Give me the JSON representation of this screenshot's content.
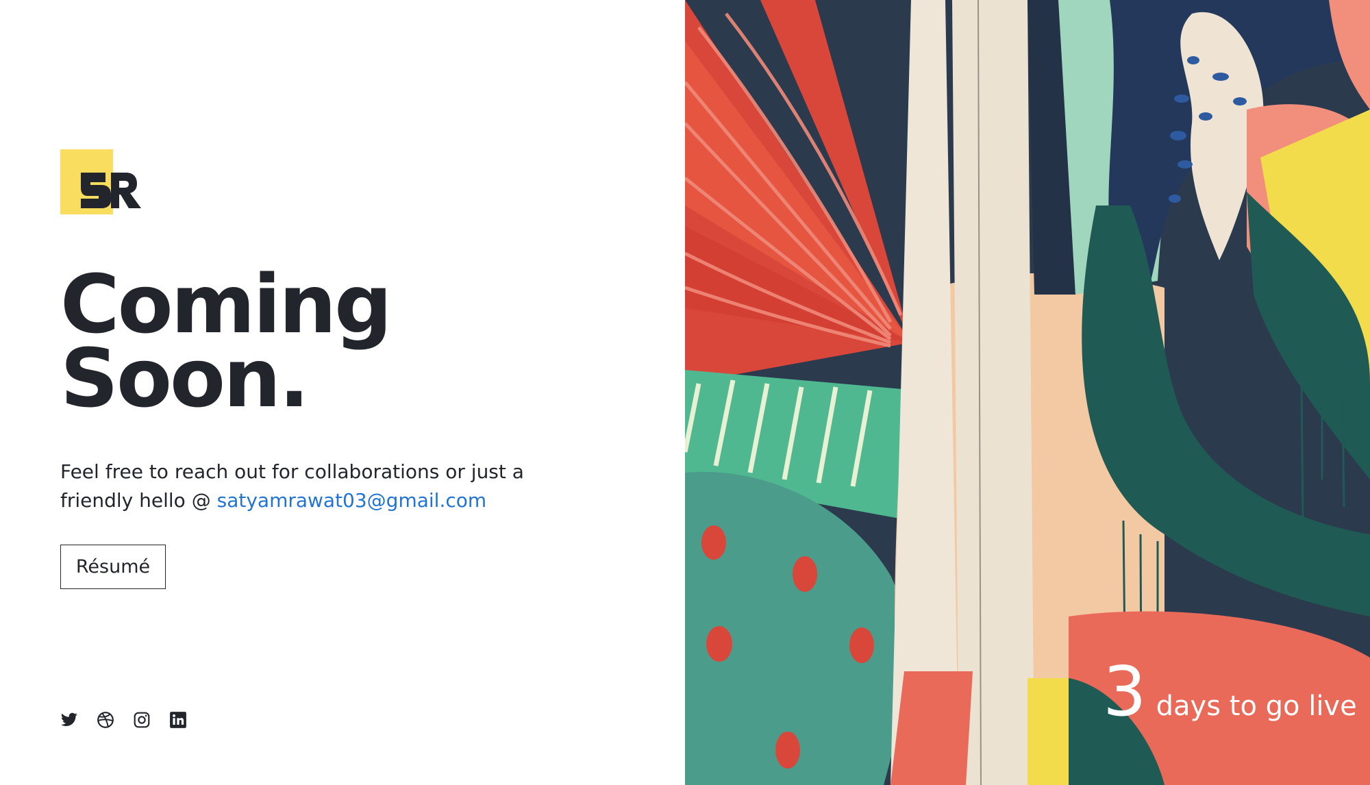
{
  "brand": {
    "logo_icon": "sr-monogram-logo",
    "accent_color": "#f8dd5e"
  },
  "headline": {
    "line1": "Coming",
    "line2": "Soon."
  },
  "blurb": {
    "text": "Feel free to reach out for collaborations or just a friendly hello @ ",
    "email": "satyamrawat03@gmail.com",
    "link_color": "#1f74d6"
  },
  "resume_button": {
    "label": "Résumé"
  },
  "socials": [
    {
      "name": "twitter-icon"
    },
    {
      "name": "dribbble-icon"
    },
    {
      "name": "instagram-icon"
    },
    {
      "name": "linkedin-icon"
    }
  ],
  "countdown": {
    "number": "3",
    "label": "days to go live"
  },
  "hero_image": {
    "description_icon": "abstract-mural-image"
  }
}
